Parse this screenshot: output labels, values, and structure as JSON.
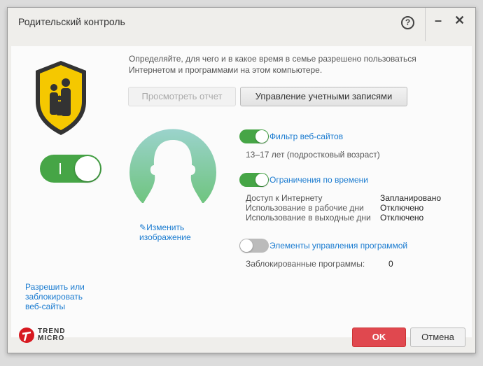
{
  "window": {
    "title": "Родительский контроль",
    "help_label": "?",
    "minimize_label": "–",
    "close_label": "✕"
  },
  "main": {
    "description": "Определяйте, для чего и в какое время в семье разрешено пользоваться Интернетом и программами на этом компьютере.",
    "view_report_label": "Просмотреть отчет",
    "manage_accounts_label": "Управление учетными записями",
    "change_image_label": "Изменить изображение",
    "allow_block_label": "Разрешить или заблокировать веб-сайты",
    "master_toggle_on": true
  },
  "features": {
    "web_filter": {
      "label": "Фильтр веб-сайтов",
      "enabled": true,
      "detail": "13–17 лет (подростковый возраст)"
    },
    "time_limits": {
      "label": "Ограничения по времени",
      "enabled": true,
      "rows": [
        {
          "label": "Доступ к Интернету",
          "value": "Запланировано"
        },
        {
          "label": "Использование в рабочие дни",
          "value": "Отключено"
        },
        {
          "label": "Использование в выходные дни",
          "value": "Отключено"
        }
      ]
    },
    "program_controls": {
      "label": "Элементы управления программой",
      "enabled": false,
      "blocked_label": "Заблокированные программы:",
      "blocked_count": "0"
    }
  },
  "footer": {
    "logo_text": "TREND MICRO",
    "ok_label": "OK",
    "cancel_label": "Отмена"
  }
}
